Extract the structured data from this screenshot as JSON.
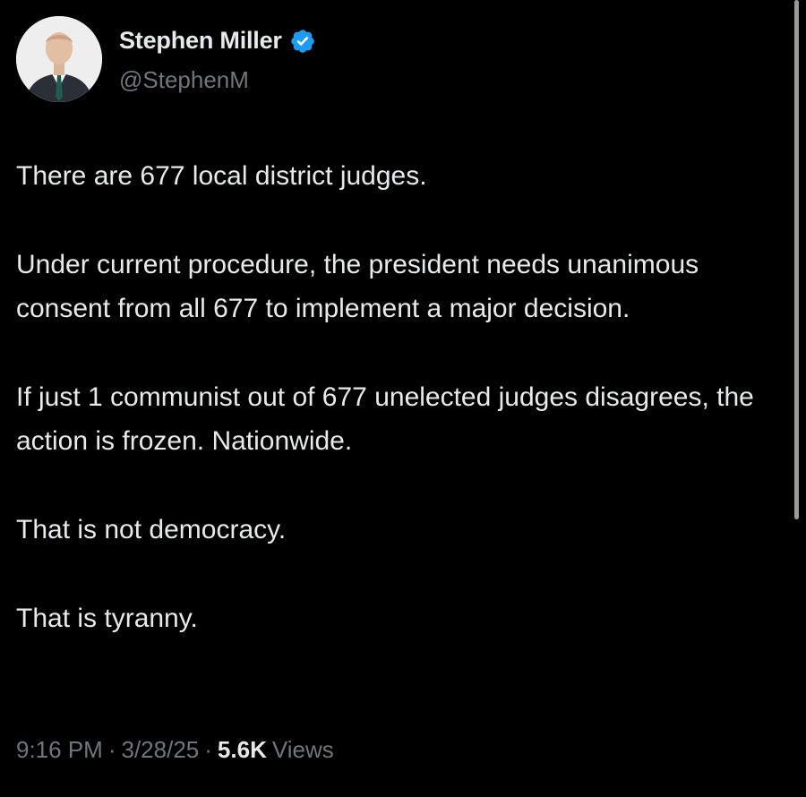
{
  "author": {
    "display_name": "Stephen Miller",
    "handle": "@StephenM",
    "verified_icon": "verified-badge-icon",
    "verified_color": "#1d9bf0"
  },
  "tweet": {
    "paragraphs": [
      "There are 677 local district judges.",
      "Under current procedure, the president needs unanimous consent from all 677 to implement a major decision.",
      "If just 1 communist out of 677 unelected judges disagrees, the action is frozen. Nationwide.",
      "That is not democracy.",
      "That is tyranny."
    ]
  },
  "meta": {
    "time": "9:16 PM",
    "separator": "·",
    "date": "3/28/25",
    "views_count": "5.6K",
    "views_label": "Views"
  },
  "colors": {
    "background": "#000000",
    "primary_text": "#e7e9ea",
    "secondary_text": "#71767b"
  }
}
